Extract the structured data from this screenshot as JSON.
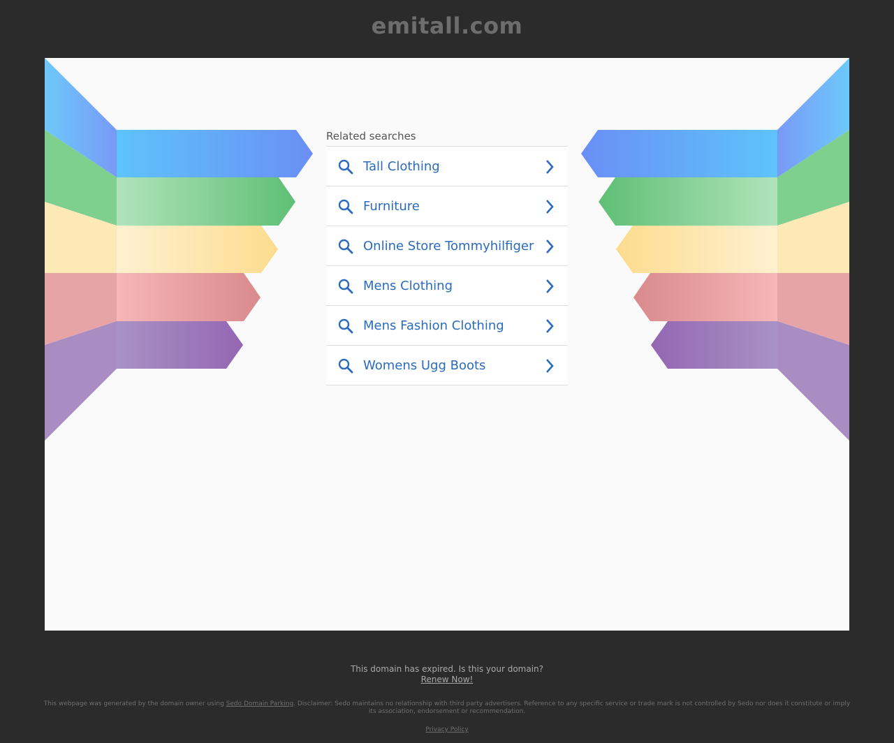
{
  "header": {
    "domain": "emitall.com"
  },
  "related": {
    "title": "Related searches",
    "items": [
      {
        "label": "Tall Clothing"
      },
      {
        "label": "Furniture"
      },
      {
        "label": "Online Store Tommyhilfiger"
      },
      {
        "label": "Mens Clothing"
      },
      {
        "label": "Mens Fashion Clothing"
      },
      {
        "label": "Womens Ugg Boots"
      }
    ]
  },
  "footer": {
    "expired_text": "This domain has expired. Is this your domain?",
    "renew_label": "Renew Now!",
    "disclaimer_prefix": "This webpage was generated by the domain owner using",
    "sedo_link": "Sedo Domain Parking",
    "disclaimer_suffix": ". Disclaimer: Sedo maintains no relationship with third party advertisers. Reference to any specific service or trade mark is not controlled by Sedo nor does it constitute or imply its association, endorsement or recommendation.",
    "privacy_label": "Privacy Policy"
  },
  "icons": {
    "search": "search-icon",
    "chevron": "chevron-right-icon"
  },
  "colors": {
    "background": "#2b2b2b",
    "panel": "#fafafa",
    "link": "#2a6bbf",
    "stripe_blue": "#5fb9f7",
    "stripe_green": "#63c47a",
    "stripe_yellow": "#fde6a8",
    "stripe_red": "#e79a9c",
    "stripe_purple": "#9a78b8"
  }
}
